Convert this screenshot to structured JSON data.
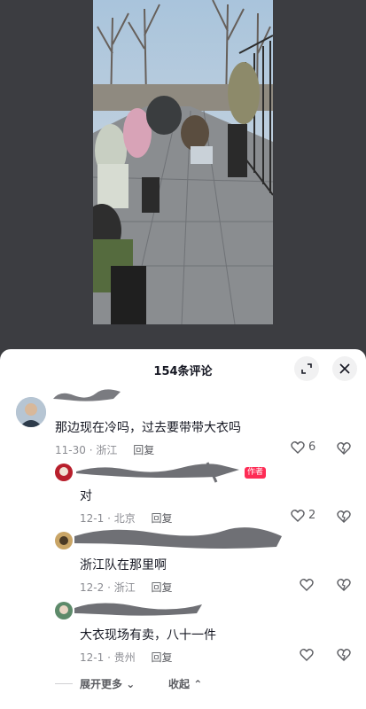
{
  "header": {
    "comment_count": "154条评论",
    "expand_icon": "expand-icon",
    "close_icon": "close-icon"
  },
  "comments": [
    {
      "text": "那边现在冷吗，过去要带带大衣吗",
      "date": "11-30",
      "location": "浙江",
      "reply_label": "回复",
      "likes": "6"
    },
    {
      "badge": "作者",
      "text": "对",
      "date": "12-1",
      "location": "北京",
      "reply_label": "回复",
      "likes": "2"
    },
    {
      "text": "浙江队在那里啊",
      "date": "12-2",
      "location": "浙江",
      "reply_label": "回复",
      "likes": ""
    },
    {
      "text": "大衣现场有卖，八十一件",
      "date": "12-1",
      "location": "贵州",
      "reply_label": "回复",
      "likes": ""
    }
  ],
  "footer": {
    "expand_more": "展开更多",
    "collapse": "收起"
  },
  "colors": {
    "accent": "#fe2c55",
    "text": "#161823",
    "muted": "#8a8b91"
  }
}
